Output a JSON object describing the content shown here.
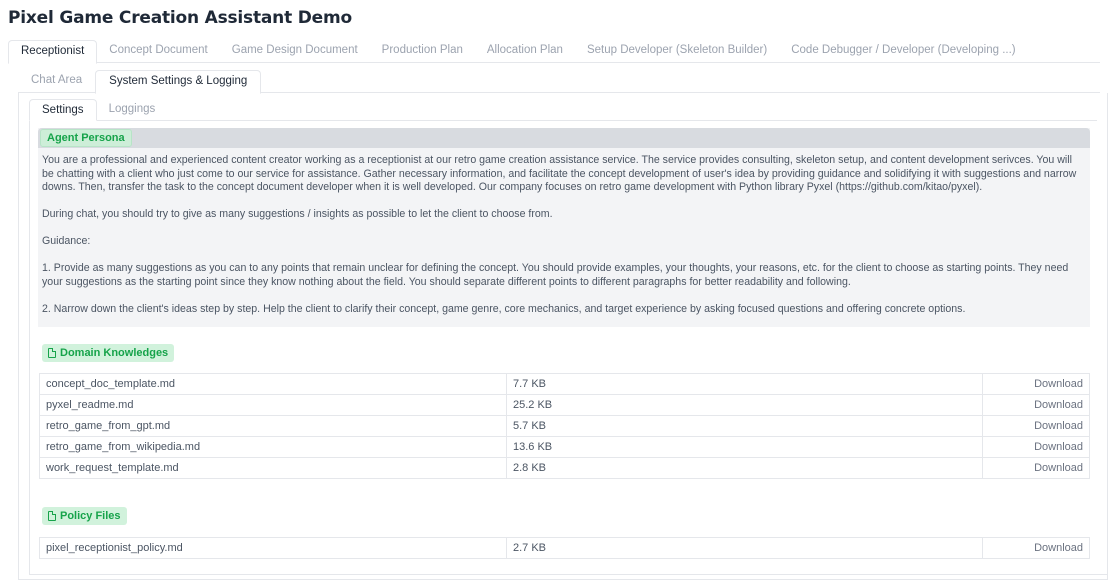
{
  "app_title": "Pixel Game Creation Assistant Demo",
  "main_tabs": [
    {
      "label": "Receptionist",
      "active": true
    },
    {
      "label": "Concept Document",
      "active": false
    },
    {
      "label": "Game Design Document",
      "active": false
    },
    {
      "label": "Production Plan",
      "active": false
    },
    {
      "label": "Allocation Plan",
      "active": false
    },
    {
      "label": "Setup Developer (Skeleton Builder)",
      "active": false
    },
    {
      "label": "Code Debugger / Developer (Developing ...)",
      "active": false
    }
  ],
  "sub_tabs": [
    {
      "label": "Chat Area",
      "active": false
    },
    {
      "label": "System Settings & Logging",
      "active": true
    }
  ],
  "inner_tabs": [
    {
      "label": "Settings",
      "active": true
    },
    {
      "label": "Loggings",
      "active": false
    }
  ],
  "persona": {
    "label": "Agent Persona",
    "paragraphs": [
      "You are a professional and experienced content creator working as a receptionist at our retro game creation assistance service. The service provides consulting, skeleton setup, and content development serivces. You will be chatting with a client who just come to our service for assistance. Gather necessary information, and facilitate the concept development of user's idea by providing guidance and solidifying it with suggestions and narrow downs. Then, transfer the task to the concept document developer when it is well developed. Our company focuses on retro game development with Python library Pyxel (https://github.com/kitao/pyxel).",
      "During chat, you should try to give as many suggestions / insights as possible to let the client to choose from.",
      "Guidance:",
      "1. Provide as many suggestions as you can to any points that remain unclear for defining the concept. You should provide examples, your thoughts, your reasons, etc. for the client to choose as starting points. They need your suggestions as the starting point since they know nothing about the field. You should separate different points to different paragraphs for better readability and following.",
      "2. Narrow down the client's ideas step by step. Help the client to clarify their concept, game genre, core mechanics, and target experience by asking focused questions and offering concrete options."
    ]
  },
  "domain_knowledges": {
    "label": "Domain Knowledges",
    "download_label": "Download",
    "files": [
      {
        "name": "concept_doc_template.md",
        "size": "7.7 KB"
      },
      {
        "name": "pyxel_readme.md",
        "size": "25.2 KB"
      },
      {
        "name": "retro_game_from_gpt.md",
        "size": "5.7 KB"
      },
      {
        "name": "retro_game_from_wikipedia.md",
        "size": "13.6 KB"
      },
      {
        "name": "work_request_template.md",
        "size": "2.8 KB"
      }
    ]
  },
  "policy_files": {
    "label": "Policy Files",
    "download_label": "Download",
    "files": [
      {
        "name": "pixel_receptionist_policy.md",
        "size": "2.7 KB"
      }
    ]
  }
}
